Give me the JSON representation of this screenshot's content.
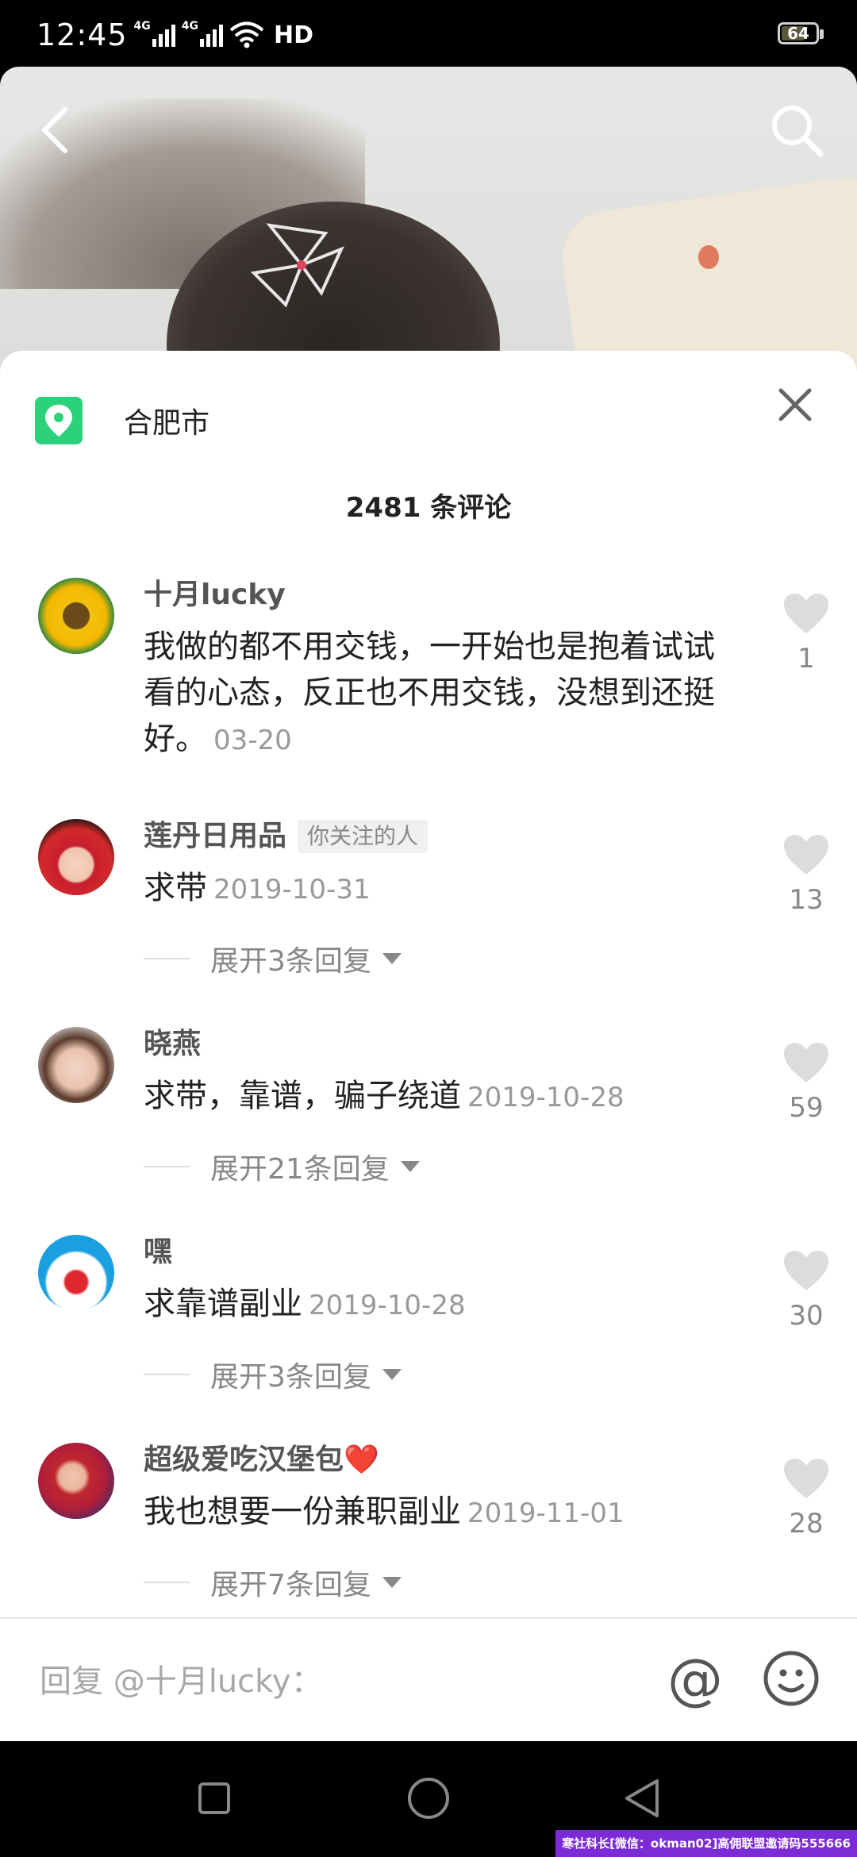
{
  "status_bar": {
    "time": "12:45",
    "net1": "4G",
    "net2": "4G",
    "hd": "HD",
    "battery": "64"
  },
  "location": {
    "name": "合肥市"
  },
  "comments_header": {
    "count_text": "2481 条评论"
  },
  "comments": [
    {
      "user": "十月lucky",
      "badge": "",
      "text": "我做的都不用交钱，一开始也是抱着试试看的心态，反正也不用交钱，没想到还挺好。",
      "date": "03-20",
      "likes": "1",
      "replies": ""
    },
    {
      "user": "莲丹日用品",
      "badge": "你关注的人",
      "text": "求带",
      "date": "2019-10-31",
      "likes": "13",
      "replies": "展开3条回复"
    },
    {
      "user": "晓燕",
      "badge": "",
      "text": "求带，靠谱，骗子绕道",
      "date": "2019-10-28",
      "likes": "59",
      "replies": "展开21条回复"
    },
    {
      "user": "嘿",
      "badge": "",
      "text": "求靠谱副业",
      "date": "2019-10-28",
      "likes": "30",
      "replies": "展开3条回复"
    },
    {
      "user": "超级爱吃汉堡包❤️",
      "badge": "",
      "text": "我也想要一份兼职副业",
      "date": "2019-11-01",
      "likes": "28",
      "replies": "展开7条回复"
    }
  ],
  "reply_bar": {
    "placeholder": "回复 @十月lucky：",
    "at_symbol": "@"
  },
  "watermark": "寒社科长[微信：okman02]高佣联盟邀请码555666",
  "colors": {
    "location_green": "#2bd27c",
    "heart_gray": "#dcdcdc"
  }
}
